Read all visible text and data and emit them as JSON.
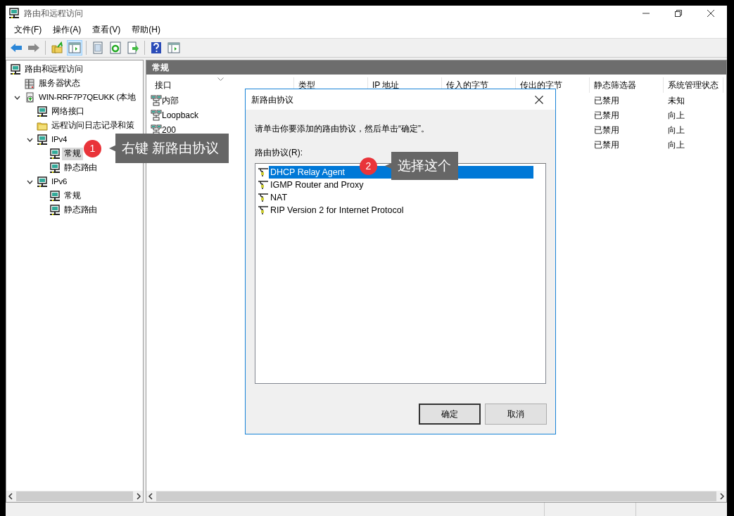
{
  "window": {
    "title": "路由和远程访问"
  },
  "menu": [
    "文件(F)",
    "操作(A)",
    "查看(V)",
    "帮助(H)"
  ],
  "toolbar": [
    {
      "kind": "back",
      "pressed": false
    },
    {
      "kind": "forward",
      "pressed": false
    },
    {
      "kind": "separator"
    },
    {
      "kind": "up",
      "pressed": false
    },
    {
      "kind": "panel",
      "pressed": true
    },
    {
      "kind": "separator"
    },
    {
      "kind": "document",
      "pressed": false
    },
    {
      "kind": "refresh",
      "pressed": false
    },
    {
      "kind": "export",
      "pressed": false
    },
    {
      "kind": "separator"
    },
    {
      "kind": "help",
      "pressed": false
    },
    {
      "kind": "panel",
      "pressed": false
    }
  ],
  "tree": [
    {
      "label": "路由和远程访问",
      "kind": "node",
      "selected": false,
      "children": [
        {
          "label": "服务器状态",
          "kind": "servers",
          "selected": false
        },
        {
          "label": "WIN-RRF7P7QEUKK (本地",
          "kind": "computer",
          "selected": false,
          "expanded": true,
          "children": [
            {
              "label": "网络接口",
              "kind": "node",
              "selected": false
            },
            {
              "label": "远程访问日志记录和策",
              "kind": "folder",
              "selected": false
            },
            {
              "label": "IPv4",
              "kind": "node",
              "selected": false,
              "expanded": true,
              "children": [
                {
                  "label": "常规",
                  "kind": "node",
                  "selected": true
                },
                {
                  "label": "静态路由",
                  "kind": "node",
                  "selected": false
                }
              ]
            },
            {
              "label": "IPv6",
              "kind": "node",
              "selected": false,
              "expanded": true,
              "children": [
                {
                  "label": "常规",
                  "kind": "node",
                  "selected": false
                },
                {
                  "label": "静态路由",
                  "kind": "node",
                  "selected": false
                }
              ]
            }
          ]
        }
      ]
    }
  ],
  "content": {
    "header": "常规",
    "columns": [
      "接口",
      "类型",
      "IP 地址",
      "传入的字节",
      "传出的字节",
      "静态筛选器",
      "系统管理状态"
    ],
    "rows": [
      {
        "interface": "内部",
        "static_filter": "已禁用",
        "admin_status": "未知"
      },
      {
        "interface": "Loopback",
        "static_filter": "已禁用",
        "admin_status": "向上"
      },
      {
        "interface": "200",
        "static_filter": "已禁用",
        "admin_status": "向上"
      },
      {
        "static_filter": "已禁用",
        "admin_status": "向上"
      }
    ]
  },
  "dialog": {
    "title": "新路由协议",
    "instruction": "请单击你要添加的路由协议，然后单击“确定”。",
    "list_label": "路由协议(R):",
    "items": [
      {
        "label": "DHCP Relay Agent",
        "selected": true
      },
      {
        "label": "IGMP Router and Proxy",
        "selected": false
      },
      {
        "label": "NAT",
        "selected": false
      },
      {
        "label": "RIP Version 2 for Internet Protocol",
        "selected": false
      }
    ],
    "buttons": [
      "确定",
      "取消"
    ]
  },
  "annotations": [
    {
      "number": "1",
      "text": "右键 新路由协议"
    },
    {
      "number": "2",
      "text": "选择这个"
    }
  ]
}
